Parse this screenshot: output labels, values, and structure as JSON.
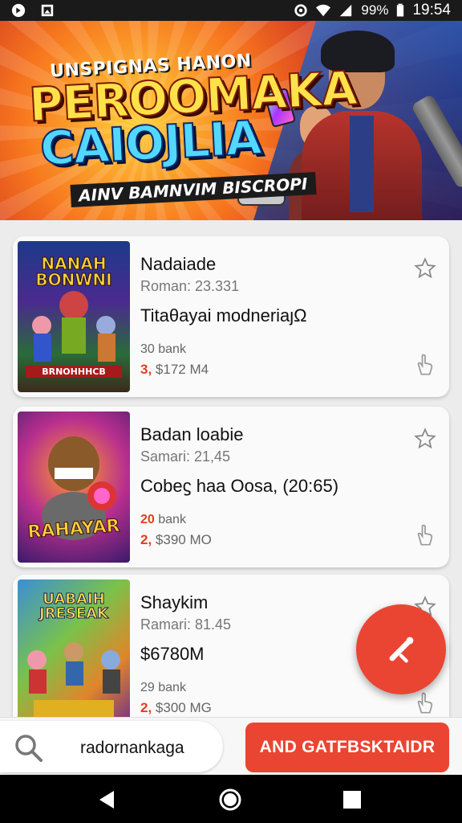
{
  "status_bar": {
    "battery": "99%",
    "time": "19:54",
    "icons": [
      "app-icon",
      "image-icon",
      "settings-icon",
      "wifi-icon",
      "signal-icon",
      "battery-icon"
    ]
  },
  "banner": {
    "line1": "UNSPIGNAS HANON",
    "line2": "PEROOMAKA",
    "line3": "CAIOJLIA",
    "line4": "AINV BAMNVIM BISCROPI"
  },
  "items": [
    {
      "title": "Nadaiade",
      "subtitle": "Roman: 23.331",
      "description": "Titaθayai modneriaȷΩ",
      "meta_count": "30",
      "meta_label": "bank",
      "price_num": "3,",
      "price_rest": "$172 M4",
      "thumb_caption_top": "NANAH BONWNI",
      "thumb_caption_bottom": "BRNOHHHCB"
    },
    {
      "title": "Badan loabie",
      "subtitle": "Samari: 21,45",
      "description": "Cobeϛ haa Οosa, (20:65)",
      "meta_count": "20",
      "meta_label": "bank",
      "price_num": "2,",
      "price_rest": "$390 MO",
      "thumb_caption_top": "",
      "thumb_caption_bottom": "RAHAYAR"
    },
    {
      "title": "Shaykim",
      "subtitle": "Ramari: 81.45",
      "description": "$6780M",
      "meta_count": "29",
      "meta_label": "bank",
      "price_num": "2,",
      "price_rest": "$300 MG",
      "thumb_caption_top": "UABAIH JRESEAK",
      "thumb_caption_bottom": ""
    }
  ],
  "search": {
    "query": "radornankaga"
  },
  "cta": {
    "label": "AND GATFBSKTAIDR"
  },
  "colors": {
    "accent": "#ea4532",
    "status_bar": "#1a1a1a",
    "card_bg": "#fafafa"
  },
  "nav": [
    "back-icon",
    "home-icon",
    "recents-icon"
  ]
}
